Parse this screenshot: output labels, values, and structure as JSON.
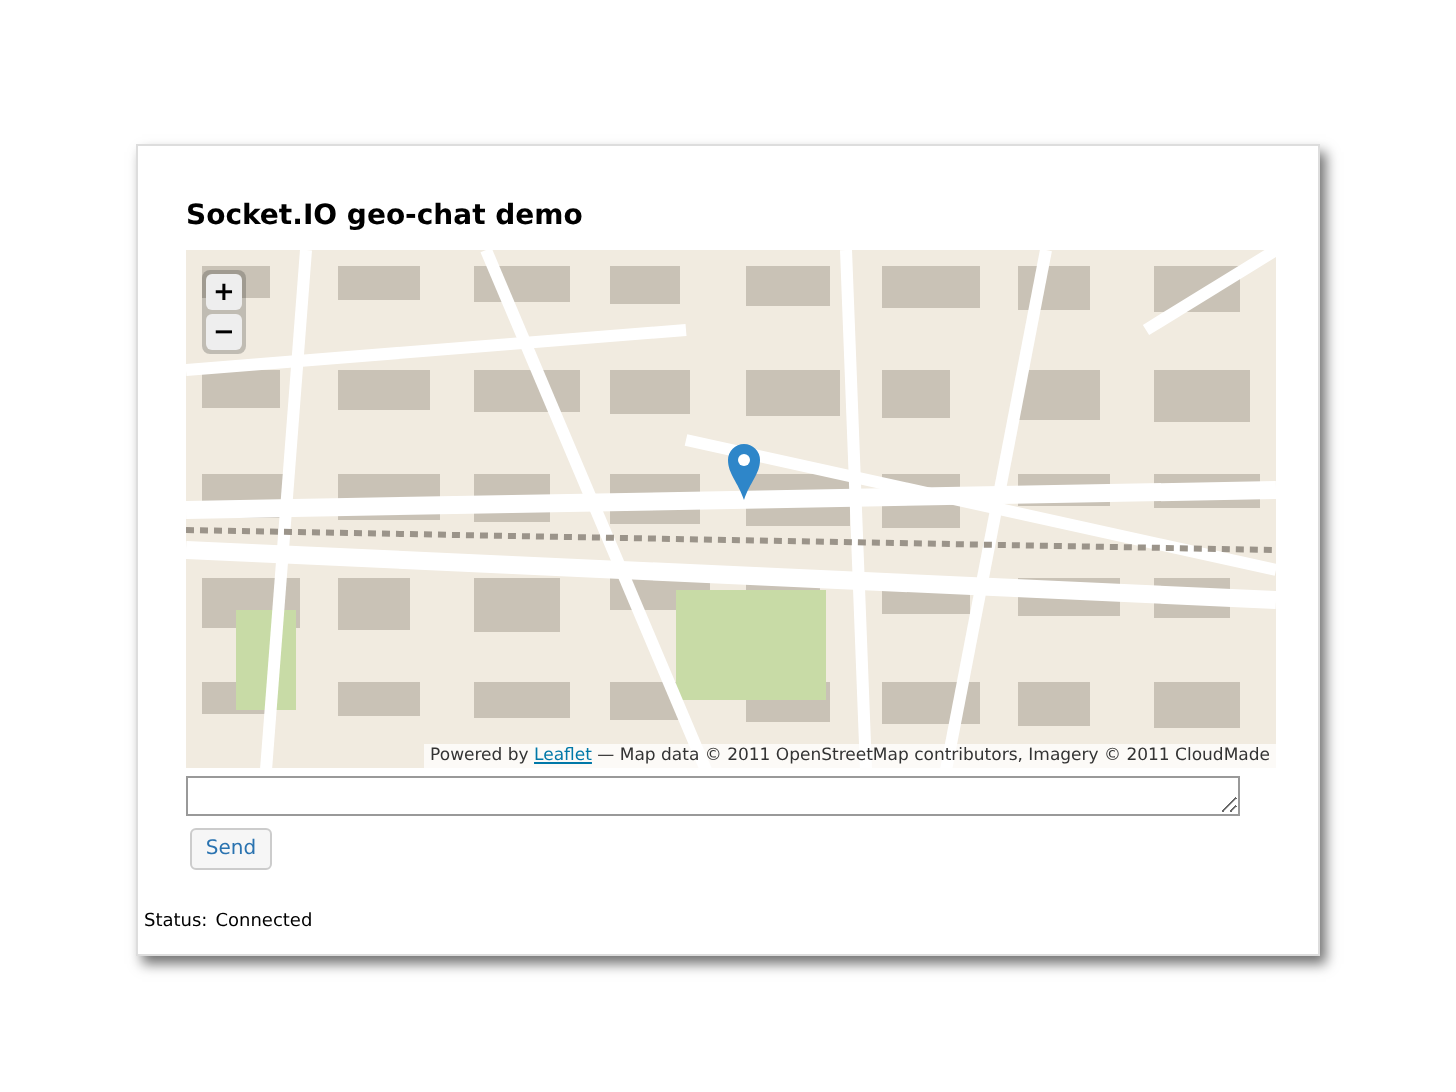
{
  "title": "Socket.IO geo-chat demo",
  "map": {
    "zoom_controls": [
      "+",
      "−"
    ],
    "attribution": {
      "prefix": "Powered by",
      "link": "Leaflet",
      "text": "— Map data © 2011 OpenStreetMap contributors, Imagery © 2011 CloudMade"
    }
  },
  "send_button": "Send",
  "status": {
    "label": "Status:",
    "value": "Connected"
  }
}
